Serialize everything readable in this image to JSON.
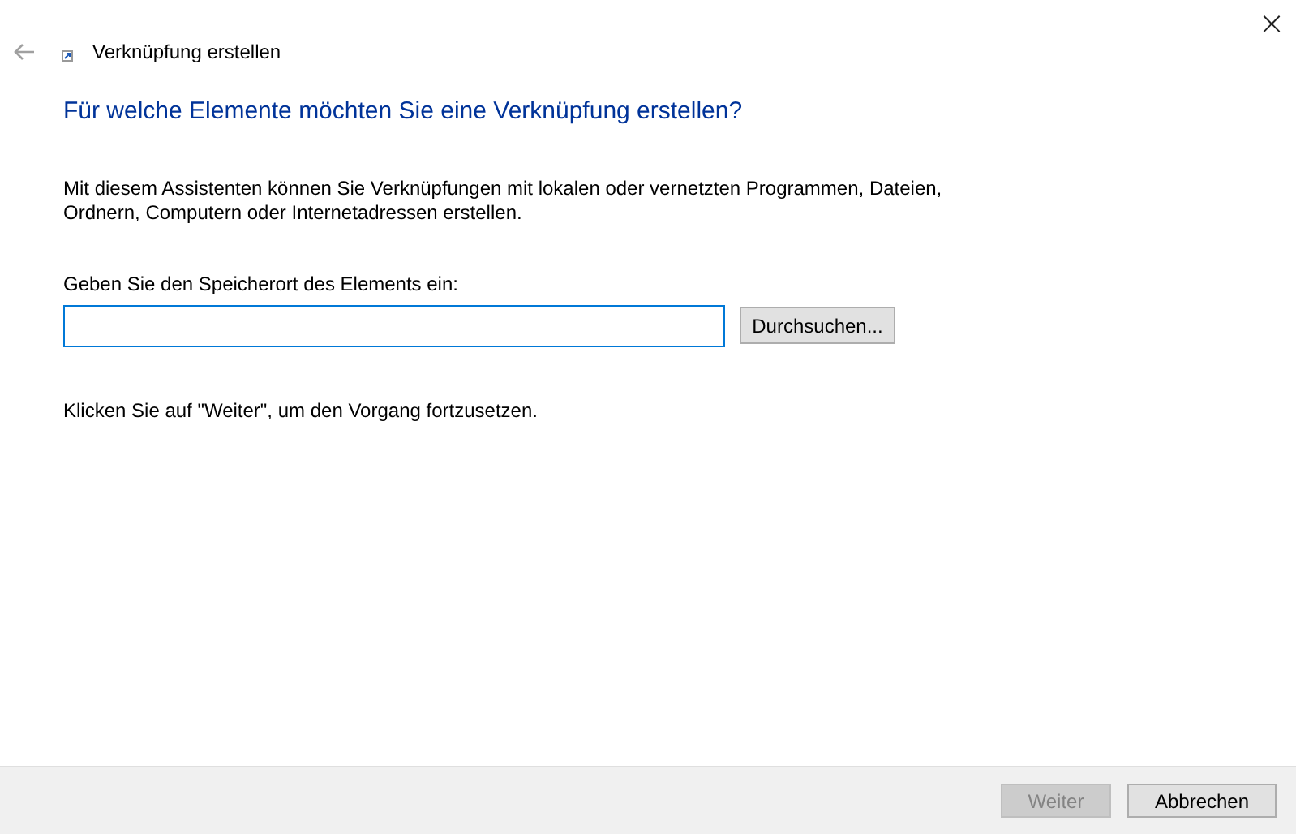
{
  "window": {
    "title": "Verknüpfung erstellen",
    "close": "×",
    "back_disabled": true
  },
  "heading": "Für welche Elemente möchten Sie eine Verknüpfung erstellen?",
  "description": "Mit diesem Assistenten können Sie Verknüpfungen mit lokalen oder vernetzten Programmen, Dateien, Ordnern, Computern oder Internetadressen erstellen.",
  "location": {
    "label": "Geben Sie den Speicherort des Elements ein:",
    "focused": true,
    "browse_button": "Durchsuchen..."
  },
  "hint": "Klicken Sie auf \"Weiter\", um den Vorgang fortzusetzen.",
  "buttons": [
    {
      "label": "Weiter",
      "disabled": true
    },
    {
      "label": "Abbrechen",
      "disabled": false
    }
  ]
}
